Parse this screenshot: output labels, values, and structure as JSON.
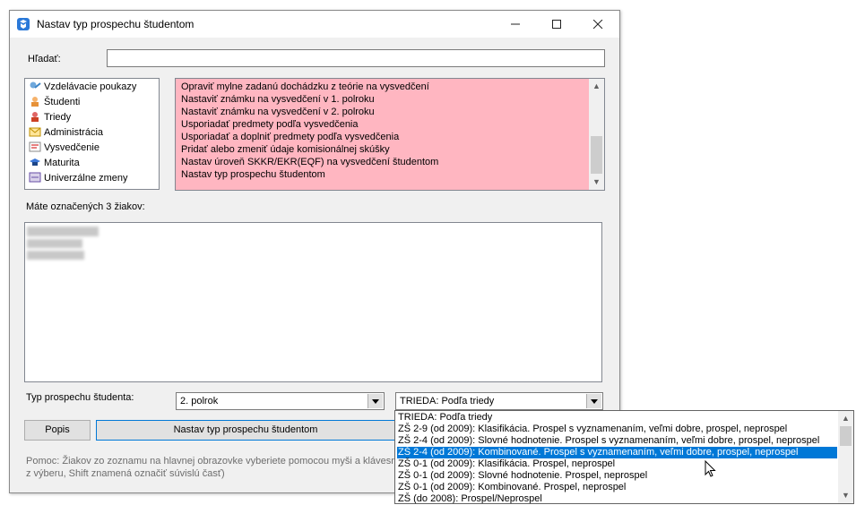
{
  "window": {
    "title": "Nastav typ prospechu študentom",
    "minimize_glyph": "–",
    "maximize_glyph": "☐",
    "close_glyph": "✕"
  },
  "search": {
    "label": "Hľadať:",
    "value": ""
  },
  "tree": {
    "items": [
      {
        "label": "Vzdelávacie poukazy",
        "icon": "voucher-icon"
      },
      {
        "label": "Študenti",
        "icon": "student-icon"
      },
      {
        "label": "Triedy",
        "icon": "class-icon"
      },
      {
        "label": "Administrácia",
        "icon": "envelope-icon"
      },
      {
        "label": "Vysvedčenie",
        "icon": "certificate-icon"
      },
      {
        "label": "Maturita",
        "icon": "graduation-cap-icon"
      },
      {
        "label": "Univerzálne zmeny",
        "icon": "universal-changes-icon"
      }
    ]
  },
  "actions": {
    "background": "#ffb6c1",
    "items": [
      "Opraviť mylne zadanú dochádzku z teórie na vysvedčení",
      "Nastaviť známku na vysvedčení v 1. polroku",
      "Nastaviť známku na vysvedčení v 2. polroku",
      "Usporiadať predmety podľa vysvedčenia",
      "Usporiadať a doplniť predmety podľa vysvedčenia",
      "Pridať alebo zmeniť údaje komisionálnej skúšky",
      "Nastav úroveň SKKR/EKR(EQF) na vysvedčení študentom",
      "Nastav typ prospechu študentom"
    ]
  },
  "selected_students": {
    "label": "Máte označených 3 žiakov:",
    "count": 3
  },
  "type_field": {
    "label": "Typ prospechu študenta:",
    "term_value": "2. polrok",
    "type_value": "TRIEDA: Podľa triedy"
  },
  "buttons": {
    "describe": "Popis",
    "apply": "Nastav typ prospechu študentom"
  },
  "help": {
    "line1": "Pomoc: Žiakov zo zoznamu na hlavnej obrazovke vyberiete pomocou myši a klávesn",
    "line2": "z výberu, Shift znamená označiť súvislú časť)"
  },
  "dropdown": {
    "selected_index": 3,
    "selection_color": "#0078d7",
    "options": [
      "TRIEDA: Podľa triedy",
      "ZŠ 2-9 (od 2009): Klasifikácia. Prospel s vyznamenaním, veľmi dobre, prospel, neprospel",
      "ZŠ 2-4 (od 2009): Slovné hodnotenie. Prospel s vyznamenaním, veľmi dobre, prospel, neprospel",
      "ZŠ 2-4 (od 2009): Kombinované. Prospel s vyznamenaním, veľmi dobre, prospel, neprospel",
      "ZŠ 0-1 (od 2009): Klasifikácia. Prospel, neprospel",
      "ZŠ 0-1 (od 2009): Slovné hodnotenie. Prospel, neprospel",
      "ZŠ 0-1 (od 2009): Kombinované. Prospel, neprospel",
      "ZŠ (do 2008): Prospel/Neprospel"
    ]
  }
}
